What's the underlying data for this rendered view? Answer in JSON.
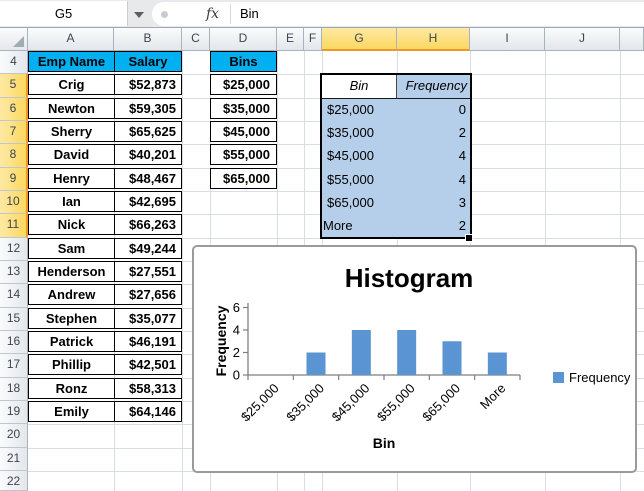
{
  "formula_bar": {
    "cell_reference": "G5",
    "fx_label": "fx",
    "formula": "Bin"
  },
  "sheet": {
    "columns": [
      "A",
      "B",
      "C",
      "D",
      "E",
      "F",
      "G",
      "H",
      "I",
      "J",
      ""
    ],
    "row_numbers": [
      4,
      5,
      6,
      7,
      8,
      9,
      10,
      11,
      12,
      13,
      14,
      15,
      16,
      17,
      18,
      19,
      20,
      21,
      22
    ],
    "selected_columns": [
      "G",
      "H"
    ],
    "selected_row_numbers": [
      5,
      6,
      7,
      8,
      9,
      10,
      11
    ]
  },
  "employee_table": {
    "headers": [
      "Emp Name",
      "Salary"
    ],
    "rows": [
      [
        "Crig",
        "$52,873"
      ],
      [
        "Newton",
        "$59,305"
      ],
      [
        "Sherry",
        "$65,625"
      ],
      [
        "David",
        "$40,201"
      ],
      [
        "Henry",
        "$48,467"
      ],
      [
        "Ian",
        "$42,695"
      ],
      [
        "Nick",
        "$66,263"
      ],
      [
        "Sam",
        "$49,244"
      ],
      [
        "Henderson",
        "$27,551"
      ],
      [
        "Andrew",
        "$27,656"
      ],
      [
        "Stephen",
        "$35,077"
      ],
      [
        "Patrick",
        "$46,191"
      ],
      [
        "Phillip",
        "$42,501"
      ],
      [
        "Ronz",
        "$58,313"
      ],
      [
        "Emily",
        "$64,146"
      ]
    ]
  },
  "bins_table": {
    "header": "Bins",
    "values": [
      "$25,000",
      "$35,000",
      "$45,000",
      "$55,000",
      "$65,000"
    ]
  },
  "frequency_table": {
    "headers": [
      "Bin",
      "Frequency"
    ],
    "rows": [
      [
        "$25,000",
        "0"
      ],
      [
        "$35,000",
        "2"
      ],
      [
        "$45,000",
        "4"
      ],
      [
        "$55,000",
        "4"
      ],
      [
        "$65,000",
        "3"
      ],
      [
        "More",
        "2"
      ]
    ]
  },
  "chart_data": {
    "type": "bar",
    "title": "Histogram",
    "categories": [
      "$25,000",
      "$35,000",
      "$45,000",
      "$55,000",
      "$65,000",
      "More"
    ],
    "values": [
      0,
      2,
      4,
      4,
      3,
      2
    ],
    "xlabel": "Bin",
    "ylabel": "Frequency",
    "ylim": [
      0,
      6
    ],
    "yticks": [
      0,
      2,
      4,
      6
    ],
    "legend": [
      "Frequency"
    ],
    "legend_position": "right",
    "grid": false,
    "bar_color": "#5B94D2"
  },
  "colors": {
    "table_header_fill": "#00B0F0",
    "selection_fill": "#B5CEE9",
    "selected_header_fill": "#FBD860",
    "selected_header_border": "#EF9729",
    "bar_color": "#5B94D2",
    "axis_color": "#7F7F7F"
  }
}
